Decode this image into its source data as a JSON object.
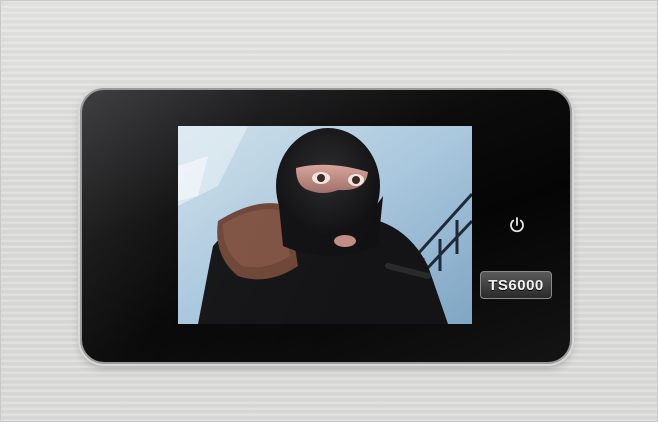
{
  "device": {
    "model_label": "TS6000",
    "power_icon": "power-icon"
  },
  "colors": {
    "wall": "#dcdcda",
    "bezel": "#0a0a0a",
    "screen_sky": "#a9c7dd",
    "balaclava": "#141414"
  }
}
